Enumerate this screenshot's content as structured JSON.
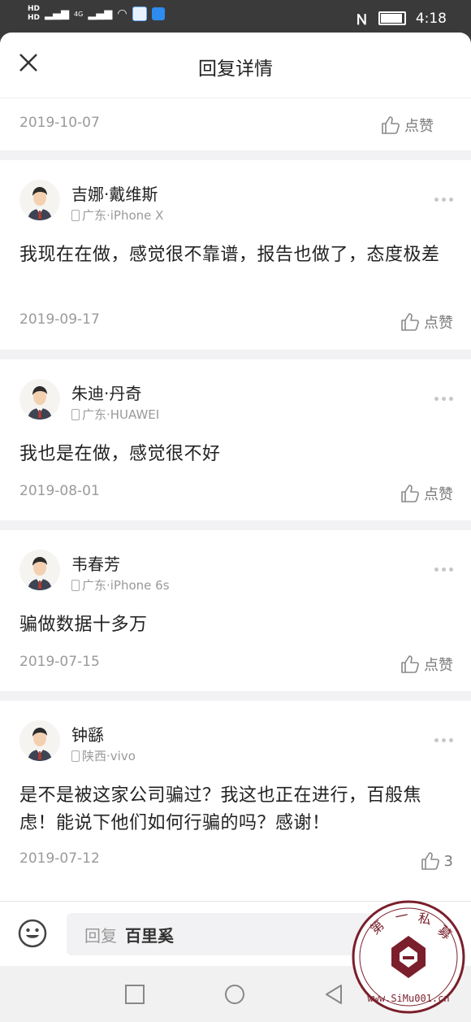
{
  "status": {
    "signal_labels": [
      "HD",
      "4G",
      "HD",
      "4G"
    ],
    "time": "4:18"
  },
  "header": {
    "title": "回复详情"
  },
  "top_reply": {
    "date": "2019-10-07",
    "like_label": "点赞"
  },
  "comments": [
    {
      "name": "吉娜·戴维斯",
      "device": "广东·iPhone X",
      "text": "我现在在做，感觉很不靠谱，报告也做了，态度极差",
      "date": "2019-09-17",
      "like_label": "点赞"
    },
    {
      "name": "朱迪·丹奇",
      "device": "广东·HUAWEI",
      "text": "我也是在做，感觉很不好",
      "date": "2019-08-01",
      "like_label": "点赞"
    },
    {
      "name": "韦春芳",
      "device": "广东·iPhone 6s",
      "text": "骗做数据十多万",
      "date": "2019-07-15",
      "like_label": "点赞"
    },
    {
      "name": "钟繇",
      "device": "陕西·vivo",
      "text": "是不是被这家公司骗过？我这也正在进行，百般焦虑！能说下他们如何行骗的吗？感谢！",
      "date": "2019-07-12",
      "like_label": "3"
    }
  ],
  "reply_bar": {
    "prefix": "回复",
    "target": "百里奚"
  },
  "watermark": {
    "text": "第一私募",
    "url": "www.SiMu001.cn"
  },
  "colors": {
    "accent_stamp": "#7a1f2b",
    "divider": "#f2f2f4"
  }
}
